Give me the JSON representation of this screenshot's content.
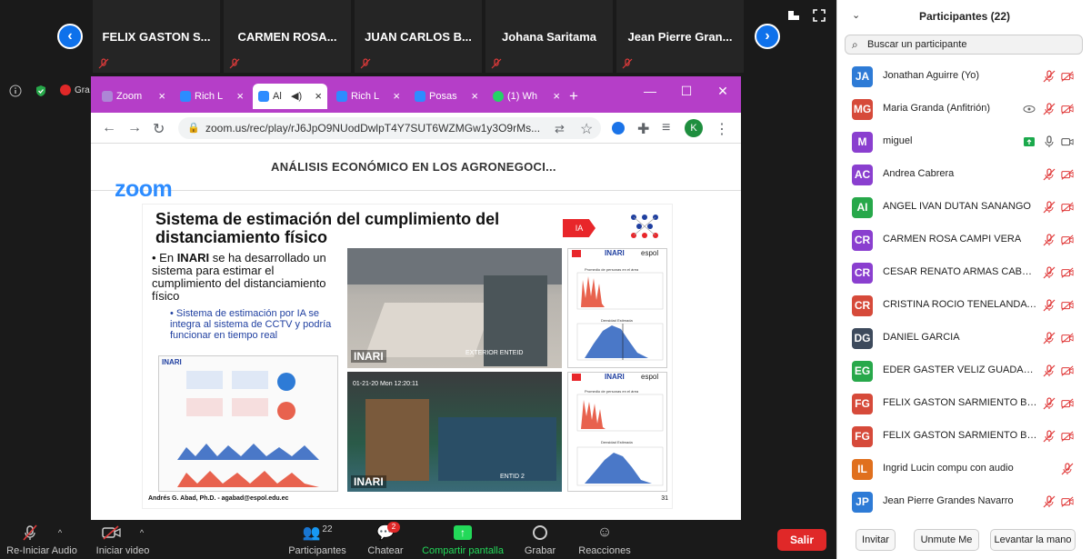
{
  "gallery": {
    "tiles": [
      "FELIX GASTON S...",
      "CARMEN  ROSA...",
      "JUAN CARLOS B...",
      "Johana Saritama",
      "Jean Pierre Gran..."
    ]
  },
  "share": {
    "label": "Gra",
    "tabs": [
      {
        "title": "Zoom",
        "active": false
      },
      {
        "title": "Rich L",
        "active": false
      },
      {
        "title": "Al",
        "active": true
      },
      {
        "title": "Rich L",
        "active": false
      },
      {
        "title": "Posas",
        "active": false
      },
      {
        "title": "(1) Wh",
        "active": false
      }
    ],
    "url": "zoom.us/rec/play/rJ6JpO9NUodDwlpT4Y7SUT6WZMGw1y3O9rMs...",
    "profile_initial": "K",
    "page_title": "ANÁLISIS ECONÓMICO EN LOS AGRONEGOCI...",
    "logo": "zoom"
  },
  "slide": {
    "title": "Sistema de estimación del cumplimiento del distanciamiento físico",
    "badge": "IA",
    "logo_text": "INARI",
    "bullet_prefix": "En ",
    "bullet_bold": "INARI",
    "bullet_rest": " se ha desarrollado un sistema para estimar el cumplimiento del distanciamiento físico",
    "sub_bullet": "Sistema de estimación por IA se integra al sistema de CCTV y podría funcionar en tiempo real",
    "footer": "Andrés G. Abad, Ph.D. - agabad@espol.edu.ec",
    "page_number": "31",
    "cam_tag": "INARI",
    "espol": "espol",
    "cam_ts": "01-21-20  Mon 12:20:11",
    "cam_lbl1": "EXTERIOR ENTEID",
    "cam_lbl2": "ENTID 2",
    "chart_t1": "Promedio de personas en el área",
    "chart_t2": "Densidad Estimada"
  },
  "toolbar": {
    "audio": "Re-Iniciar Audio",
    "video": "Iniciar video",
    "participants": "Participantes",
    "participants_count": "22",
    "chat": "Chatear",
    "chat_badge": "2",
    "share": "Compartir pantalla",
    "record": "Grabar",
    "reactions": "Reacciones",
    "leave": "Salir"
  },
  "panel": {
    "title": "Participantes (22)",
    "search_placeholder": "Buscar un participante",
    "participants": [
      {
        "initials": "JA",
        "name": "Jonathan Aguirre (Yo)",
        "color": "#2e7bd6"
      },
      {
        "initials": "MG",
        "name": "Maria Granda (Anfitrión)",
        "color": "#d64a3a"
      },
      {
        "initials": "M",
        "name": "miguel",
        "color": "#8a3fcf"
      },
      {
        "initials": "AC",
        "name": "Andrea Cabrera",
        "color": "#8a3fcf"
      },
      {
        "initials": "AI",
        "name": "ANGEL IVAN DUTAN SANANGO",
        "color": "#27a84a"
      },
      {
        "initials": "CR",
        "name": "CARMEN ROSA CAMPI VERA",
        "color": "#8a3fcf"
      },
      {
        "initials": "CR",
        "name": "CESAR RENATO ARMAS CABRERA",
        "color": "#8a3fcf"
      },
      {
        "initials": "CR",
        "name": "CRISTINA ROCIO TENELANDA ...",
        "color": "#d64a3a"
      },
      {
        "initials": "DG",
        "name": "DANIEL GARCIA",
        "color": "#3d4a5c"
      },
      {
        "initials": "EG",
        "name": "EDER GASTER VELIZ GUADAMUD",
        "color": "#27a84a"
      },
      {
        "initials": "FG",
        "name": "FELIX GASTON SARMIENTO BOL...",
        "color": "#d64a3a"
      },
      {
        "initials": "FG",
        "name": "FELIX GASTON SARMIENTO BOL...",
        "color": "#d64a3a"
      },
      {
        "initials": "IL",
        "name": "Ingrid Lucin compu con audio",
        "color": "#e0701e"
      },
      {
        "initials": "JP",
        "name": "Jean Pierre Grandes Navarro",
        "color": "#2e7bd6"
      }
    ],
    "invite": "Invitar",
    "unmute": "Unmute Me",
    "raise_hand": "Levantar la mano"
  },
  "colors": {
    "accent": "#0e71eb",
    "leave": "#e02828",
    "tabstrip": "#b53ec8",
    "muted": "#e03a3a"
  }
}
